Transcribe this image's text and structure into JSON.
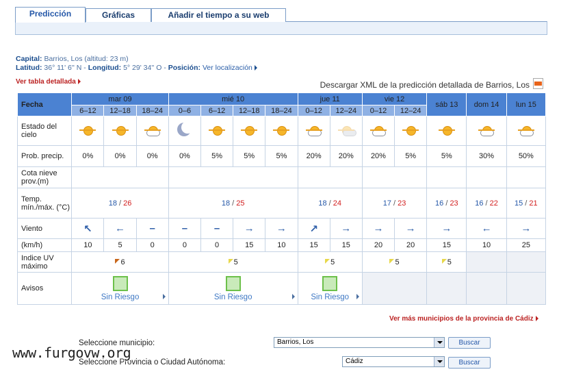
{
  "tabs": [
    {
      "label": "Predicción",
      "active": true
    },
    {
      "label": "Gráficas",
      "active": false
    },
    {
      "label": "Añadir el tiempo a su web",
      "active": false
    }
  ],
  "location": {
    "capital_label": "Capital:",
    "capital_value": "Barrios, Los (altitud: 23 m)",
    "lat_label": "Latitud:",
    "lat_value": "36° 11' 6'' N",
    "lon_label": "Longitud:",
    "lon_value": "5° 29' 34'' O",
    "pos_label": "Posición:",
    "pos_link": "Ver localización"
  },
  "links": {
    "ver_tabla": "Ver tabla detallada",
    "xml": "Descargar XML de la predicción detallada de Barrios, Los",
    "ver_mas": "Ver más municipios de la provincia de Cádiz"
  },
  "table": {
    "fecha": "Fecha",
    "days": [
      "mar 09",
      "mié 10",
      "jue 11",
      "vie 12",
      "sáb 13",
      "dom 14",
      "lun 15"
    ],
    "periods": [
      "6–12",
      "12–18",
      "18–24",
      "0–6",
      "6–12",
      "12–18",
      "18–24",
      "0–12",
      "12–24",
      "0–12",
      "12–24"
    ],
    "row_labels": {
      "estado": "Estado del cielo",
      "prob": "Prob. precip.",
      "cota": "Cota nieve prov.(m)",
      "temp": "Temp. mín./máx. (°C)",
      "viento": "Viento",
      "kmh": "(km/h)",
      "uv": "Indice UV máximo",
      "avisos": "Avisos"
    },
    "sky": [
      "sun",
      "sun",
      "sun-cloud",
      "moon",
      "sun",
      "sun",
      "sun",
      "sun-cloud",
      "cloud",
      "sun-cloud",
      "sun",
      "sun",
      "sun-cloud",
      "sun-cloud"
    ],
    "prob": [
      "0%",
      "0%",
      "0%",
      "0%",
      "5%",
      "5%",
      "5%",
      "20%",
      "20%",
      "20%",
      "5%",
      "5%",
      "30%",
      "50%"
    ],
    "temp": [
      {
        "min": "18",
        "max": "26"
      },
      {
        "min": "18",
        "max": "25"
      },
      {
        "min": "18",
        "max": "24"
      },
      {
        "min": "17",
        "max": "23"
      },
      {
        "min": "16",
        "max": "23"
      },
      {
        "min": "16",
        "max": "22"
      },
      {
        "min": "15",
        "max": "21"
      }
    ],
    "temp_sep": "/",
    "wind_arrows": [
      "↖",
      "←",
      "–",
      "–",
      "–",
      "→",
      "→",
      "↗",
      "→",
      "→",
      "→",
      "→",
      "←",
      "→"
    ],
    "wind_speed": [
      "10",
      "5",
      "0",
      "0",
      "0",
      "15",
      "10",
      "15",
      "15",
      "20",
      "20",
      "15",
      "10",
      "25"
    ],
    "uv": [
      "6",
      "5",
      "5",
      "5",
      "5"
    ],
    "aviso_label": "Sin Riesgo"
  },
  "form": {
    "municipio_label": "Seleccione municipio:",
    "municipio_value": "Barrios, Los",
    "provincia_label": "Seleccione Provincia o Ciudad Autónoma:",
    "provincia_value": "Cádiz",
    "buscar": "Buscar"
  },
  "watermark": "www.furgovw.org"
}
